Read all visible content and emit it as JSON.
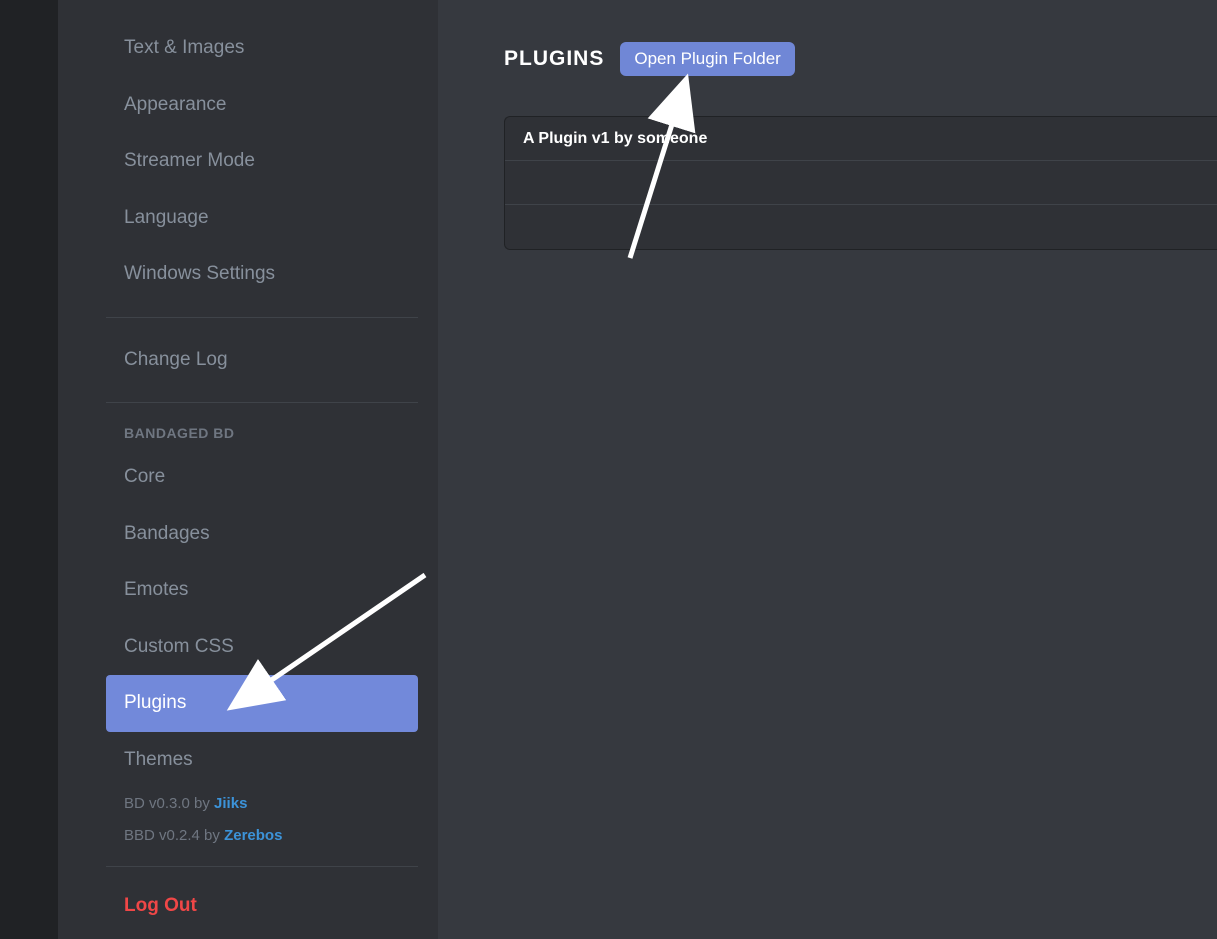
{
  "sidebar": {
    "items": [
      {
        "label": "Text & Images",
        "active": false
      },
      {
        "label": "Appearance",
        "active": false
      },
      {
        "label": "Streamer Mode",
        "active": false
      },
      {
        "label": "Language",
        "active": false
      },
      {
        "label": "Windows Settings",
        "active": false
      }
    ],
    "changelog": {
      "label": "Change Log"
    },
    "bandaged": {
      "header": "BANDAGED BD",
      "items": [
        {
          "label": "Core",
          "active": false
        },
        {
          "label": "Bandages",
          "active": false
        },
        {
          "label": "Emotes",
          "active": false
        },
        {
          "label": "Custom CSS",
          "active": false
        },
        {
          "label": "Plugins",
          "active": true
        },
        {
          "label": "Themes",
          "active": false
        }
      ]
    },
    "versions": {
      "bd_prefix": "BD v0.3.0 by ",
      "bd_author": "Jiiks",
      "bbd_prefix": "BBD v0.2.4 by ",
      "bbd_author": "Zerebos"
    },
    "logout": {
      "label": "Log Out"
    }
  },
  "content": {
    "title": "PLUGINS",
    "folder_button": "Open Plugin Folder",
    "plugin": {
      "title": "A Plugin v1 by someone"
    }
  },
  "colors": {
    "accent": "#7289da",
    "link": "#3c93d9",
    "danger": "#f04747"
  }
}
